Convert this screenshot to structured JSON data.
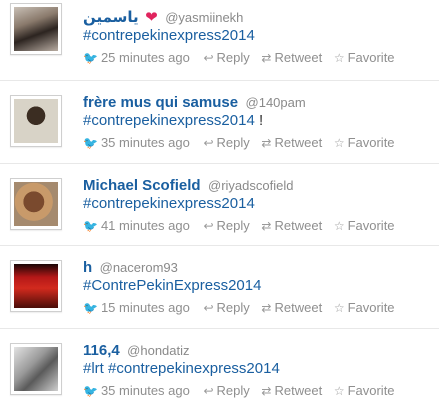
{
  "icons": {
    "bird": "🐦",
    "reply": "↩",
    "retweet": "⇄",
    "favorite": "☆",
    "heart": "❤"
  },
  "actions": {
    "reply": "Reply",
    "retweet": "Retweet",
    "favorite": "Favorite"
  },
  "colors": {
    "name": "#1a5fa0",
    "hashtag": "#1a5fa0",
    "meta": "#8f8f8f",
    "heart": "#e0245e"
  },
  "tweets": [
    {
      "name": "ياسمين",
      "handle": "@yasmiinekh",
      "text": "#contrepekinexpress2014",
      "suffix": "",
      "time": "25 minutes ago"
    },
    {
      "name": "frère mus qui samuse",
      "handle": "@140pam",
      "text": "#contrepekinexpress2014",
      "suffix": " !",
      "time": "35 minutes ago"
    },
    {
      "name": "Michael Scofield",
      "handle": "@riyadscofield",
      "text": "#contrepekinexpress2014",
      "suffix": "",
      "time": "41 minutes ago"
    },
    {
      "name": "h",
      "handle": "@nacerom93",
      "text": "#ContrePekinExpress2014",
      "suffix": "",
      "time": "15 minutes ago"
    },
    {
      "name": "116,4",
      "handle": "@hondatiz",
      "text": "#lrt #contrepekinexpress2014",
      "suffix": "",
      "time": "35 minutes ago"
    }
  ]
}
